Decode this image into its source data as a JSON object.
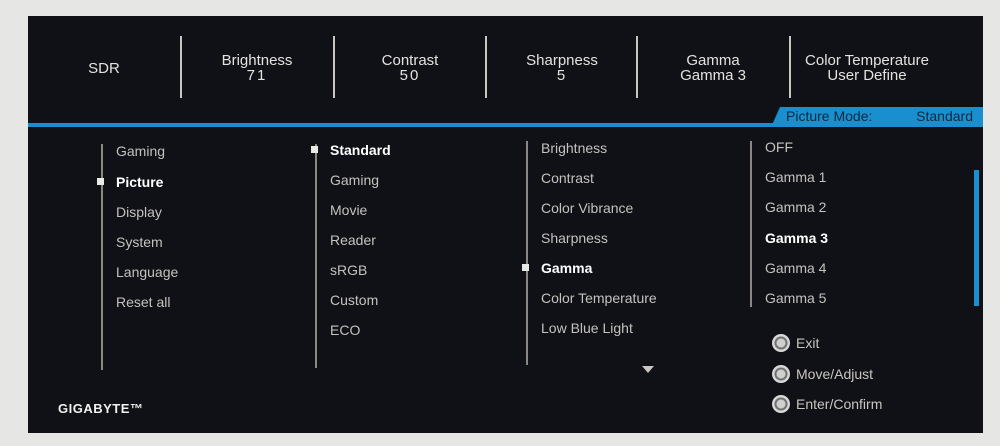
{
  "header": {
    "mode": "SDR",
    "cells": [
      {
        "label": "Brightness",
        "value": "71"
      },
      {
        "label": "Contrast",
        "value": "50"
      },
      {
        "label": "Sharpness",
        "value": "5"
      },
      {
        "label": "Gamma",
        "value": "Gamma 3"
      },
      {
        "label": "Color Temperature",
        "value": "User Define"
      }
    ]
  },
  "picture_mode": {
    "label": "Picture Mode:",
    "value": "Standard"
  },
  "main_menu": [
    "Gaming",
    "Picture",
    "Display",
    "System",
    "Language",
    "Reset all"
  ],
  "main_menu_selected": "Picture",
  "picture_modes": [
    "Standard",
    "Gaming",
    "Movie",
    "Reader",
    "sRGB",
    "Custom",
    "ECO"
  ],
  "picture_mode_selected": "Standard",
  "settings": [
    "Brightness",
    "Contrast",
    "Color Vibrance",
    "Sharpness",
    "Gamma",
    "Color Temperature",
    "Low Blue Light"
  ],
  "settings_selected": "Gamma",
  "gamma_options": [
    "OFF",
    "Gamma 1",
    "Gamma 2",
    "Gamma 3",
    "Gamma 4",
    "Gamma 5"
  ],
  "gamma_selected": "Gamma 3",
  "nav_hints": {
    "exit": "Exit",
    "move": "Move/Adjust",
    "enter": "Enter/Confirm"
  },
  "brand": "GIGABYTE™",
  "colors": {
    "accent": "#1a8fd0",
    "background": "#101116",
    "text": "#c4c2bd"
  }
}
